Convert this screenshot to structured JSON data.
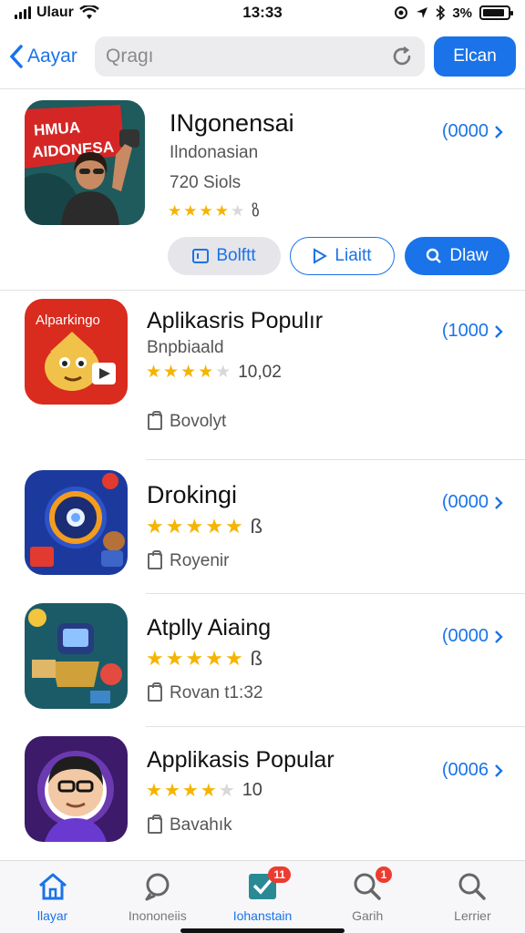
{
  "status_bar": {
    "carrier": "Ulaur",
    "time": "13:33",
    "battery": "3%",
    "battery_level": 0.9
  },
  "nav": {
    "back_label": "Aayar",
    "search_placeholder": "Qragı",
    "primary_button": "Elcan"
  },
  "featured": {
    "icon_banner_line1": "HMUA",
    "icon_banner_line2": "AIDONESA",
    "title": "INgonensai",
    "subtitle": "Ilndonasian",
    "size": "720 Siols",
    "rating": 3.5,
    "rating_text": "ზ",
    "price": "(0000",
    "buttons": {
      "button1": "Bolftt",
      "button2": "Liaitt",
      "button3": "Dlaw"
    }
  },
  "apps": [
    {
      "title": "Aplikasris Populır",
      "subtitle": "Bnpbiaald",
      "rating": 3.5,
      "rating_text": "10,02",
      "meta": "Bovolyt",
      "price": "(1000",
      "icon_label": "Alparkingo",
      "icon_theme": "red"
    },
    {
      "title": "Drokingi",
      "rating": 4.5,
      "rating_text": "ß",
      "meta": "Royenir",
      "price": "(0000",
      "icon_theme": "blue"
    },
    {
      "title": "Atplly Aiaing",
      "rating": 4.5,
      "rating_text": "ß",
      "meta": "Rovan t1:32",
      "price": "(0000",
      "icon_theme": "teal"
    },
    {
      "title": "Applikasis Popular",
      "rating": 3.5,
      "rating_text": "10",
      "meta": "Bavahık",
      "price": "(0006",
      "icon_theme": "purple"
    }
  ],
  "tabs": [
    {
      "label": "llayar",
      "icon": "home-icon",
      "active": true
    },
    {
      "label": "Inononeiis",
      "icon": "chat-icon"
    },
    {
      "label": "Iohanstain",
      "icon": "check-box-icon",
      "badge": "11"
    },
    {
      "label": "Garih",
      "icon": "search-icon",
      "badge": "1"
    },
    {
      "label": "Lerrier",
      "icon": "search-icon"
    }
  ],
  "colors": {
    "accent": "#1a73e8",
    "star": "#f5b400",
    "badge": "#ee3b30"
  }
}
